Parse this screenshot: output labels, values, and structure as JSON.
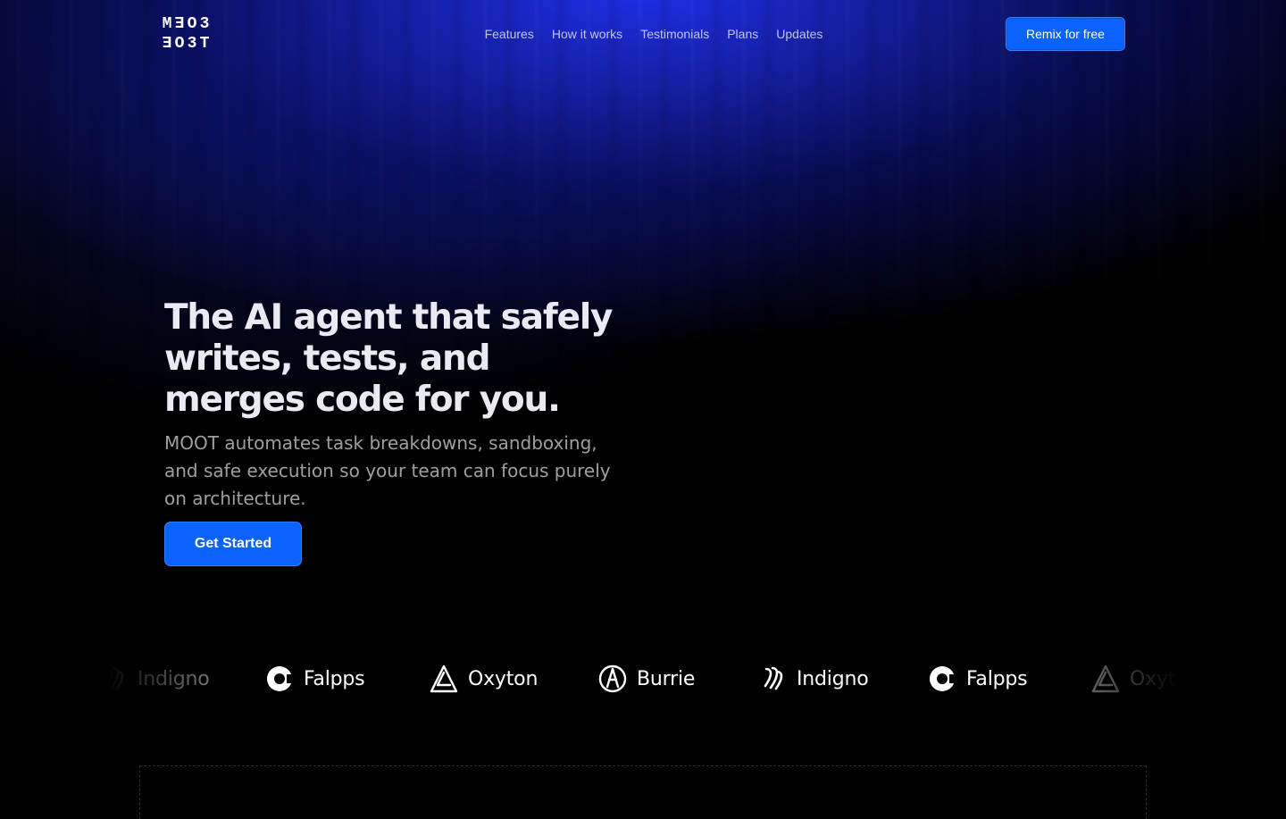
{
  "header": {
    "logo_text": "MEO3 EO3T",
    "nav": [
      "Features",
      "How it works",
      "Testimonials",
      "Plans",
      "Updates"
    ],
    "cta": "Remix for free"
  },
  "hero": {
    "title": "The AI agent that safely writes, tests, and merges code for you.",
    "subtitle": "MOOT automates task breakdowns, sandboxing, and safe execution so your team can focus purely on architecture.",
    "cta": "Get Started"
  },
  "logo_strip": [
    {
      "name": "Indigno",
      "icon": "indigno-icon"
    },
    {
      "name": "Falpps",
      "icon": "falpps-icon"
    },
    {
      "name": "Oxyton",
      "icon": "oxyton-icon"
    },
    {
      "name": "Burrie",
      "icon": "burrie-icon"
    },
    {
      "name": "Indigno",
      "icon": "indigno-icon"
    },
    {
      "name": "Falpps",
      "icon": "falpps-icon"
    },
    {
      "name": "Oxyton",
      "icon": "oxyton-icon"
    }
  ],
  "colors": {
    "accent": "#0A63FF",
    "background": "#000000"
  }
}
